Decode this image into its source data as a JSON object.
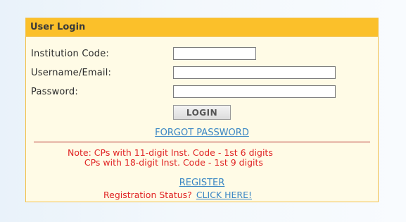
{
  "login_panel": {
    "title": "User Login",
    "fields": {
      "institution_code": {
        "label": "Institution Code:",
        "value": "",
        "placeholder": ""
      },
      "username": {
        "label": "Username/Email:",
        "value": "",
        "placeholder": ""
      },
      "password": {
        "label": "Password:",
        "value": "",
        "placeholder": ""
      }
    },
    "login_button": "LOGIN",
    "forgot_password_link": "FORGOT PASSWORD",
    "note_line1": "Note: CPs with 11-digit Inst. Code - 1st 6 digits",
    "note_line2": "      CPs with 18-digit Inst. Code - 1st 9 digits",
    "register_link": "REGISTER",
    "registration_status_text": "Registration Status?",
    "click_here_link": "CLICK HERE!"
  },
  "colors": {
    "header_bg": "#fbc02a",
    "panel_bg": "#fffbe6",
    "link": "#3a86c4",
    "note_text": "#e02424",
    "divider": "#b62b2b"
  }
}
